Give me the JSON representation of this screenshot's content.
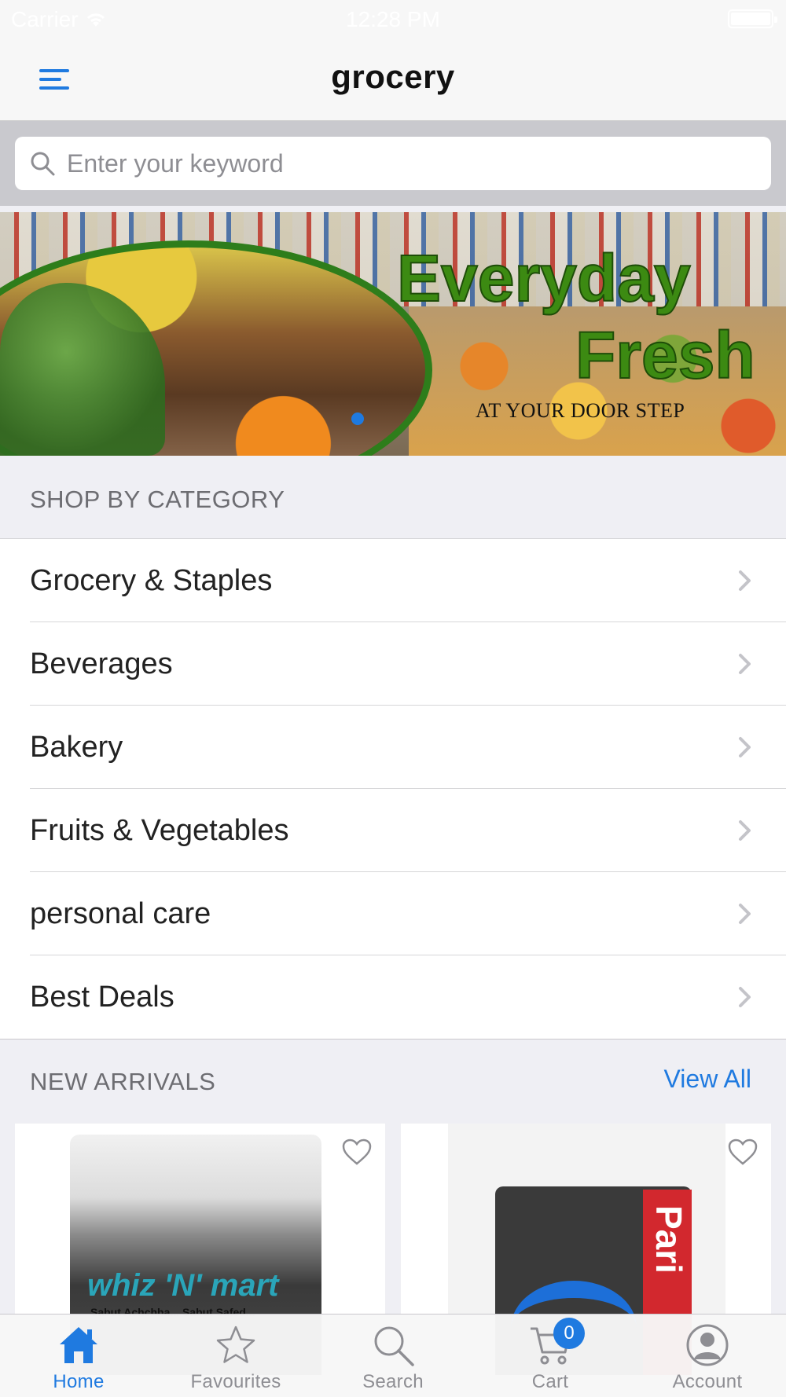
{
  "status_bar": {
    "carrier": "Carrier",
    "time": "12:28 PM"
  },
  "nav": {
    "title": "grocery",
    "menu_icon": "hamburger-menu-icon"
  },
  "search": {
    "placeholder": "Enter your keyword",
    "value": "",
    "icon": "search-icon"
  },
  "banner": {
    "headline_line1": "Everyday",
    "headline_line2": "Fresh",
    "tagline": "AT YOUR DOOR STEP",
    "slide_count": 1,
    "active_slide": 1,
    "indicator_color": "#1e7ae0"
  },
  "categories": {
    "header": "SHOP BY CATEGORY",
    "items": [
      {
        "label": "Grocery & Staples"
      },
      {
        "label": "Beverages"
      },
      {
        "label": "Bakery"
      },
      {
        "label": "Fruits & Vegetables"
      },
      {
        "label": "personal care"
      },
      {
        "label": "Best Deals"
      }
    ]
  },
  "new_arrivals": {
    "header": "NEW ARRIVALS",
    "view_all": "View All",
    "products": [
      {
        "brand_text": "whiz 'N' mart",
        "sub_text": "Sabut Achchha... Sabut Safed...",
        "favorited": false
      },
      {
        "brand_text": "Pari",
        "favorited": false
      }
    ]
  },
  "tabbar": {
    "active": "Home",
    "accent_color": "#1f7ae0",
    "tabs": [
      {
        "label": "Home",
        "icon": "home-icon"
      },
      {
        "label": "Favourites",
        "icon": "star-icon"
      },
      {
        "label": "Search",
        "icon": "search-icon"
      },
      {
        "label": "Cart",
        "icon": "cart-icon",
        "badge": "0"
      },
      {
        "label": "Account",
        "icon": "account-icon"
      }
    ]
  }
}
